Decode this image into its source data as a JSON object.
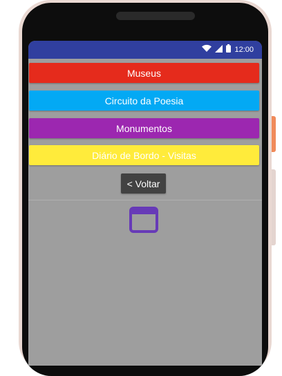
{
  "status_bar": {
    "time": "12:00",
    "icons": [
      "wifi-icon",
      "cell-signal-icon",
      "battery-icon"
    ]
  },
  "menu": {
    "buttons": [
      {
        "label": "Museus",
        "color": "#e52b1c"
      },
      {
        "label": "Circuito da Poesia",
        "color": "#03a9f4"
      },
      {
        "label": "Monumentos",
        "color": "#9c27b0"
      },
      {
        "label": "Diário de Bordo - Visitas",
        "color": "#ffeb3b"
      }
    ],
    "back_label": "< Voltar"
  },
  "colors": {
    "status_bar": "#303f9f",
    "screen_background": "#9e9e9e",
    "back_button": "#424242",
    "window_icon": "#673ab7"
  },
  "placeholder_icon": "window-icon"
}
